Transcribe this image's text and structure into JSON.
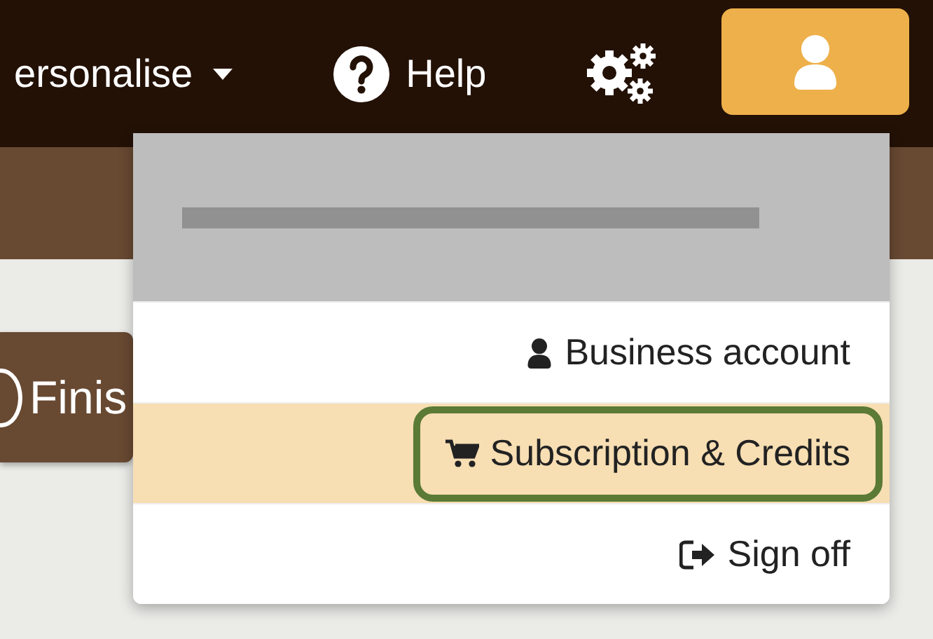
{
  "navbar": {
    "items": [
      {
        "kind": "dropdown",
        "label": "ersonalise"
      },
      {
        "kind": "help",
        "label": "Help"
      },
      {
        "kind": "settings"
      },
      {
        "kind": "account"
      }
    ]
  },
  "page": {
    "button": {
      "label": "Finis"
    }
  },
  "account_menu": {
    "header": {
      "kind": "redacted"
    },
    "items": [
      {
        "kind": "user",
        "label": "Business account",
        "selected": false,
        "outlined": false
      },
      {
        "kind": "cart",
        "label": "Subscription & Credits",
        "selected": true,
        "outlined": true
      },
      {
        "kind": "signoff",
        "label": "Sign off",
        "selected": false,
        "outlined": false
      }
    ]
  }
}
